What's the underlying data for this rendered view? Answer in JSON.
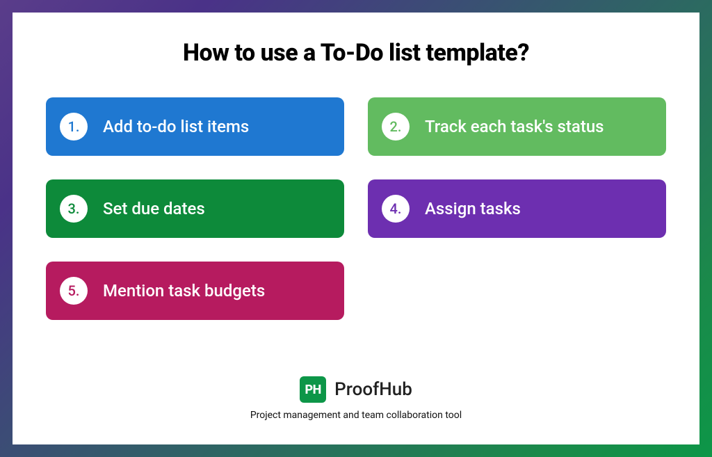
{
  "title": "How to use a To-Do list template?",
  "steps": [
    {
      "num": "1.",
      "label": "Add to-do list items",
      "bg": "#1f78d1",
      "numColor": "#1f78d1"
    },
    {
      "num": "2.",
      "label": "Track each task's status",
      "bg": "#62bb60",
      "numColor": "#62bb60"
    },
    {
      "num": "3.",
      "label": "Set due dates",
      "bg": "#0d8a3a",
      "numColor": "#0d8a3a"
    },
    {
      "num": "4.",
      "label": "Assign tasks",
      "bg": "#6d2fb0",
      "numColor": "#6d2fb0"
    },
    {
      "num": "5.",
      "label": "Mention task budgets",
      "bg": "#b61b5f",
      "numColor": "#b61b5f"
    }
  ],
  "brand": {
    "logo_text": "PH",
    "name": "ProofHub",
    "tagline": "Project management and team collaboration tool"
  }
}
